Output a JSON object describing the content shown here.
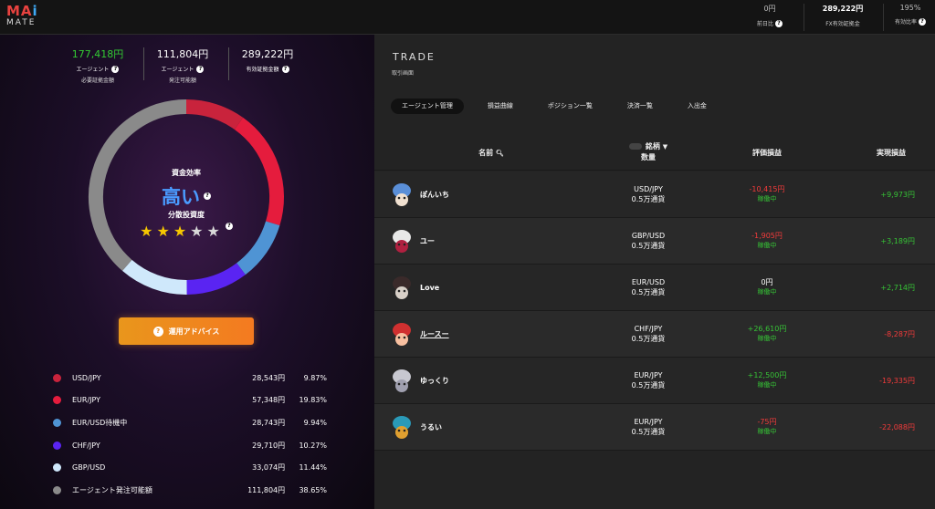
{
  "brand": {
    "l1": "MA",
    "l2": "i",
    "sub": "MATE"
  },
  "topstats": [
    {
      "value": "0円",
      "label": "前日比",
      "bright": false
    },
    {
      "value": "289,222円",
      "label": "FX有効証拠金",
      "bright": true
    },
    {
      "value": "195%",
      "label": "有効比率",
      "bright": false
    }
  ],
  "leftstats": [
    {
      "value": "177,418円",
      "label1": "エージェント",
      "label2": "必要証拠金額",
      "green": true
    },
    {
      "value": "111,804円",
      "label1": "エージェント",
      "label2": "発注可能額",
      "green": false
    },
    {
      "value": "289,222円",
      "label1": "有効証拠金額",
      "label2": "",
      "green": false
    }
  ],
  "efficiency": {
    "label": "資金効率",
    "value": "高い",
    "diversity_label": "分散投資度",
    "stars_filled": 3,
    "stars_total": 5
  },
  "advice_label": "運用アドバイス",
  "legend": [
    {
      "name": "USD/JPY",
      "amount": "28,543円",
      "pct": "9.87%",
      "color": "#c9233c",
      "share": 9.87
    },
    {
      "name": "EUR/JPY",
      "amount": "57,348円",
      "pct": "19.83%",
      "color": "#e51c3d",
      "share": 19.83
    },
    {
      "name": "EUR/USD待機中",
      "amount": "28,743円",
      "pct": "9.94%",
      "color": "#4f94d4",
      "share": 9.94
    },
    {
      "name": "CHF/JPY",
      "amount": "29,710円",
      "pct": "10.27%",
      "color": "#5a24f2",
      "share": 10.27
    },
    {
      "name": "GBP/USD",
      "amount": "33,074円",
      "pct": "11.44%",
      "color": "#cfe8fb",
      "share": 11.44
    },
    {
      "name": "エージェント発注可能額",
      "amount": "111,804円",
      "pct": "38.65%",
      "color": "#8a8a8a",
      "share": 38.65
    }
  ],
  "trade": {
    "title": "TRADE",
    "subtitle": "取引画面"
  },
  "tabs": [
    "エージェント管理",
    "損益曲線",
    "ポジション一覧",
    "決済一覧",
    "入出金"
  ],
  "headers": {
    "name": "名前",
    "symbol1": "銘柄",
    "symbol2": "数量",
    "unrealized": "評価損益",
    "realized": "実現損益"
  },
  "agents": [
    {
      "name": "ぽんいち",
      "symbol": "USD/JPY",
      "qty": "0.5万通貨",
      "pnl": "-10,415円",
      "pnl_color": "red",
      "status": "稼働中",
      "realized": "+9,973円",
      "realized_color": "green",
      "avatar": "mushroom-avatar",
      "underline": false,
      "c1": "#5a8fd8",
      "c2": "#f0e0d0"
    },
    {
      "name": "ユー",
      "symbol": "GBP/USD",
      "qty": "0.5万通貨",
      "pnl": "-1,905円",
      "pnl_color": "red",
      "status": "稼働中",
      "realized": "+3,189円",
      "realized_color": "green",
      "avatar": "ghost-avatar",
      "underline": false,
      "c1": "#e8e8e8",
      "c2": "#b02040"
    },
    {
      "name": "Love",
      "symbol": "EUR/USD",
      "qty": "0.5万通貨",
      "pnl": "0円",
      "pnl_color": "white",
      "status": "稼働中",
      "realized": "+2,714円",
      "realized_color": "green",
      "avatar": "dog-avatar",
      "underline": false,
      "c1": "#3a2a2a",
      "c2": "#d8d0c8"
    },
    {
      "name": "ルースー",
      "symbol": "CHF/JPY",
      "qty": "0.5万通貨",
      "pnl": "+26,610円",
      "pnl_color": "green",
      "status": "稼働中",
      "realized": "-8,287円",
      "realized_color": "red",
      "avatar": "red-creature-avatar",
      "underline": true,
      "c1": "#d03030",
      "c2": "#f8c0a0"
    },
    {
      "name": "ゆっくり",
      "symbol": "EUR/JPY",
      "qty": "0.5万通貨",
      "pnl": "+12,500円",
      "pnl_color": "green",
      "status": "稼働中",
      "realized": "-19,335円",
      "realized_color": "red",
      "avatar": "rabbit-avatar",
      "underline": false,
      "c1": "#c8c8d0",
      "c2": "#a0a0b0"
    },
    {
      "name": "うるい",
      "symbol": "EUR/JPY",
      "qty": "0.5万通貨",
      "pnl": "-75円",
      "pnl_color": "red",
      "status": "稼働中",
      "realized": "-22,088円",
      "realized_color": "red",
      "avatar": "dragon-avatar",
      "underline": false,
      "c1": "#2a9ab8",
      "c2": "#e0a030"
    }
  ]
}
